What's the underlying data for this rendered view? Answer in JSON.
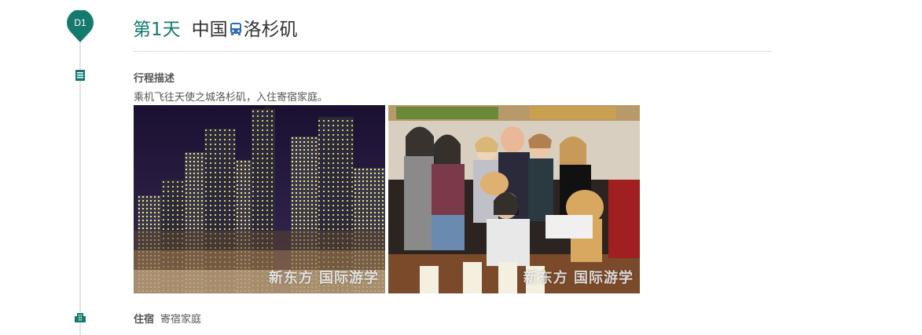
{
  "day": {
    "badge": "D1",
    "title": "第1天",
    "route_from": "中国",
    "route_to": "洛杉矶",
    "transport_icon": "bus-icon"
  },
  "itinerary": {
    "section_title": "行程描述",
    "description": "乘机飞往天使之城洛杉矶，入住寄宿家庭。",
    "photos": [
      {
        "subject": "los-angeles-night-skyline",
        "watermark": "新东方 国际游学"
      },
      {
        "subject": "host-family-group-photo",
        "watermark": "新东方 国际游学"
      }
    ]
  },
  "stay": {
    "label": "住宿",
    "value": "寄宿家庭"
  },
  "icons": {
    "description_icon": "document-icon",
    "stay_icon": "building-icon"
  },
  "colors": {
    "accent": "#147a6e",
    "timeline": "#e3e3e3",
    "text": "#333333"
  }
}
